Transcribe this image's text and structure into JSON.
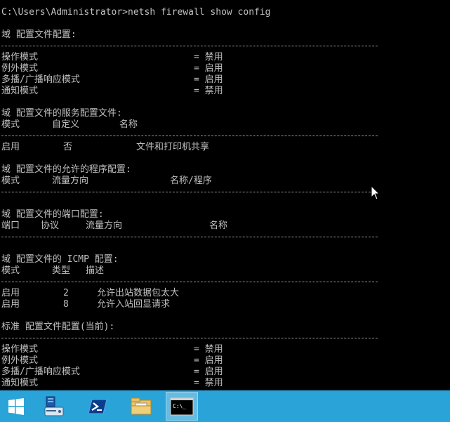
{
  "console": {
    "prompt": "C:\\Users\\Administrator>netsh firewall show config",
    "domain_profile": {
      "title": "域 配置文件配置:",
      "op_mode": "操作模式",
      "op_mode_val": "= 禁用",
      "exception_mode": "例外模式",
      "exception_mode_val": "= 启用",
      "multicast_mode": "多播/广播响应模式",
      "multicast_mode_val": "= 启用",
      "notify_mode": "通知模式",
      "notify_mode_val": "= 禁用"
    },
    "services": {
      "title": "域 配置文件的服务配置文件:",
      "headers": [
        "模式",
        "自定义",
        "名称"
      ],
      "rows": [
        {
          "mode": "启用",
          "custom": "否",
          "name": "文件和打印机共享"
        }
      ]
    },
    "programs": {
      "title": "域 配置文件的允许的程序配置:",
      "headers": [
        "模式",
        "流量方向",
        "名称/程序"
      ]
    },
    "ports": {
      "title": "域 配置文件的端口配置:",
      "headers": [
        "端口",
        "协议",
        "流量方向",
        "名称"
      ]
    },
    "icmp": {
      "title": "域 配置文件的 ICMP 配置:",
      "headers": [
        "模式",
        "类型",
        "描述"
      ],
      "rows": [
        {
          "mode": "启用",
          "type": "2",
          "desc": "允许出站数据包太大"
        },
        {
          "mode": "启用",
          "type": "8",
          "desc": "允许入站回显请求"
        }
      ]
    },
    "standard_profile": {
      "title": "标准 配置文件配置(当前):",
      "op_mode": "操作模式",
      "op_mode_val": "= 禁用",
      "exception_mode": "例外模式",
      "exception_mode_val": "= 启用",
      "multicast_mode": "多播/广播响应模式",
      "multicast_mode_val": "= 启用",
      "notify_mode": "通知模式",
      "notify_mode_val": "= 禁用"
    }
  },
  "taskbar": {
    "color": "#2aa3d8",
    "items": [
      {
        "icon": "windows-start-icon"
      },
      {
        "icon": "server-manager-icon"
      },
      {
        "icon": "powershell-icon"
      },
      {
        "icon": "file-explorer-icon"
      },
      {
        "icon": "command-prompt-icon",
        "active": true,
        "label": "C:\\_"
      }
    ]
  }
}
